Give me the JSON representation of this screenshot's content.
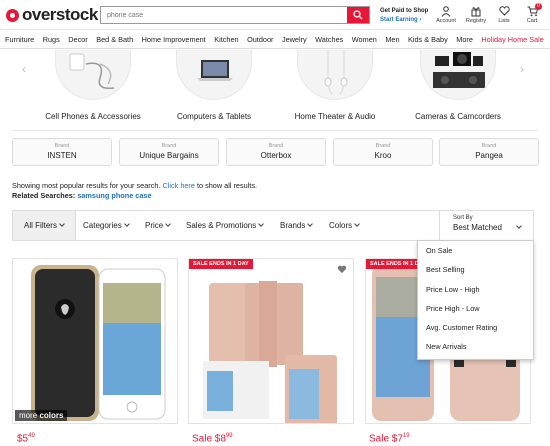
{
  "header": {
    "logo_text": "overstock",
    "search_placeholder": "phone case",
    "paid_line1": "Get Paid to Shop",
    "paid_line2": "Start Earning ›",
    "icons": [
      {
        "label": "Account",
        "icon": "user-icon"
      },
      {
        "label": "Registry",
        "icon": "gift-icon"
      },
      {
        "label": "Lists",
        "icon": "heart-icon"
      },
      {
        "label": "Cart",
        "icon": "cart-icon",
        "badge": "0"
      }
    ]
  },
  "categories": [
    "Furniture",
    "Rugs",
    "Decor",
    "Bed & Bath",
    "Home Improvement",
    "Kitchen",
    "Outdoor",
    "Jewelry",
    "Watches",
    "Women",
    "Men",
    "Kids & Baby",
    "More",
    "Holiday Home Sale"
  ],
  "carousel": [
    {
      "label": "Cell Phones & Accessories"
    },
    {
      "label": "Computers & Tablets"
    },
    {
      "label": "Home Theater & Audio"
    },
    {
      "label": "Cameras & Camcorders"
    }
  ],
  "brands": [
    {
      "label": "Brand",
      "name": "INSTEN"
    },
    {
      "label": "Brand",
      "name": "Unique Bargains"
    },
    {
      "label": "Brand",
      "name": "Otterbox"
    },
    {
      "label": "Brand",
      "name": "Kroo"
    },
    {
      "label": "Brand",
      "name": "Pangea"
    }
  ],
  "results": {
    "showing_text": "Showing most popular results for your search.",
    "click_here": "Click here",
    "showing_suffix": "to show all results.",
    "related_label": "Related Searches:",
    "related_link": "samsung phone case"
  },
  "filters": {
    "all": "All Filters",
    "items": [
      "Categories",
      "Price",
      "Sales & Promotions",
      "Brands",
      "Colors"
    ],
    "sort_label": "Sort By",
    "sort_value": "Best Matched"
  },
  "sort_options": [
    "On Sale",
    "Best Selling",
    "Price Low - High",
    "Price High - Low",
    "Avg. Customer Rating",
    "New Arrivals"
  ],
  "products": [
    {
      "tag": "",
      "more_colors_1": "more",
      "more_colors_2": "colors",
      "price_prefix": "",
      "price_dollars": "$5",
      "price_cents": "49"
    },
    {
      "tag": "SALE ENDS IN 1 DAY",
      "price_prefix": "Sale",
      "price_dollars": "$8",
      "price_cents": "99"
    },
    {
      "tag": "SALE ENDS IN 1 DAY",
      "price_prefix": "Sale",
      "price_dollars": "$7",
      "price_cents": "19"
    }
  ],
  "colors": {
    "accent": "#e51937",
    "link": "#1f73b7"
  }
}
